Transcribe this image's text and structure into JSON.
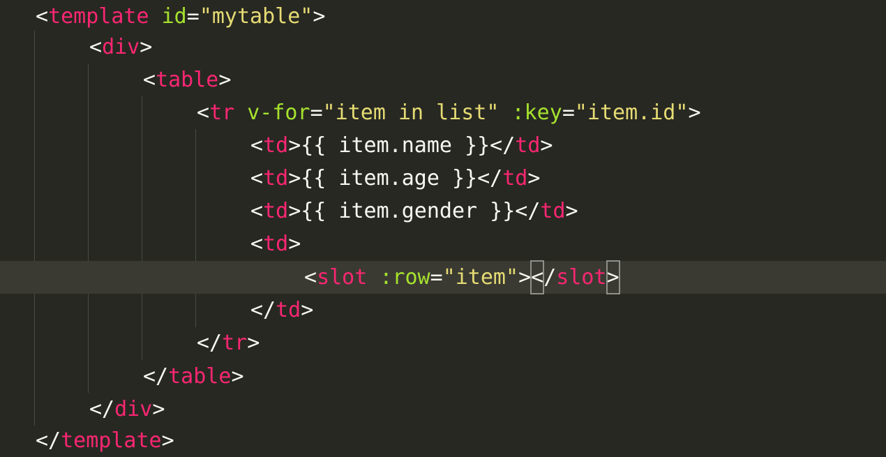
{
  "editor": {
    "theme_colors": {
      "background": "#272822",
      "tag": "#f92672",
      "attribute": "#a6e22e",
      "string": "#e6db74",
      "punctuation": "#f8f8f2",
      "active_line": "#3a3a32"
    },
    "lines": [
      {
        "tag_open": "<",
        "tag": "template",
        "attr": "id",
        "eq": "=",
        "str": "\"mytable\"",
        "tag_close": ">"
      },
      {
        "tag_open": "<",
        "tag": "div",
        "tag_close": ">"
      },
      {
        "tag_open": "<",
        "tag": "table",
        "tag_close": ">"
      },
      {
        "tag_open": "<",
        "tag": "tr",
        "attr1": "v-for",
        "eq1": "=",
        "str1": "\"item in list\"",
        "attr2": ":key",
        "eq2": "=",
        "str2": "\"item.id\"",
        "tag_close": ">"
      },
      {
        "open": "<",
        "tag": "td",
        "mid": ">{{ item.name }}</",
        "tag2": "td",
        "close": ">"
      },
      {
        "open": "<",
        "tag": "td",
        "mid": ">{{ item.age }}</",
        "tag2": "td",
        "close": ">"
      },
      {
        "open": "<",
        "tag": "td",
        "mid": ">{{ item.gender }}</",
        "tag2": "td",
        "close": ">"
      },
      {
        "tag_open": "<",
        "tag": "td",
        "tag_close": ">"
      },
      {
        "tag_open": "<",
        "tag": "slot",
        "attr": ":row",
        "eq": "=",
        "str": "\"item\"",
        "gt": ">",
        "lt_box": "<",
        "slash": "/",
        "tag2": "slot",
        "gt_box": ">"
      },
      {
        "tag_open": "</",
        "tag": "td",
        "tag_close": ">"
      },
      {
        "tag_open": "</",
        "tag": "tr",
        "tag_close": ">"
      },
      {
        "tag_open": "</",
        "tag": "table",
        "tag_close": ">"
      },
      {
        "tag_open": "</",
        "tag": "div",
        "tag_close": ">"
      },
      {
        "tag_open": "</",
        "tag": "template",
        "tag_close": ">"
      }
    ]
  }
}
